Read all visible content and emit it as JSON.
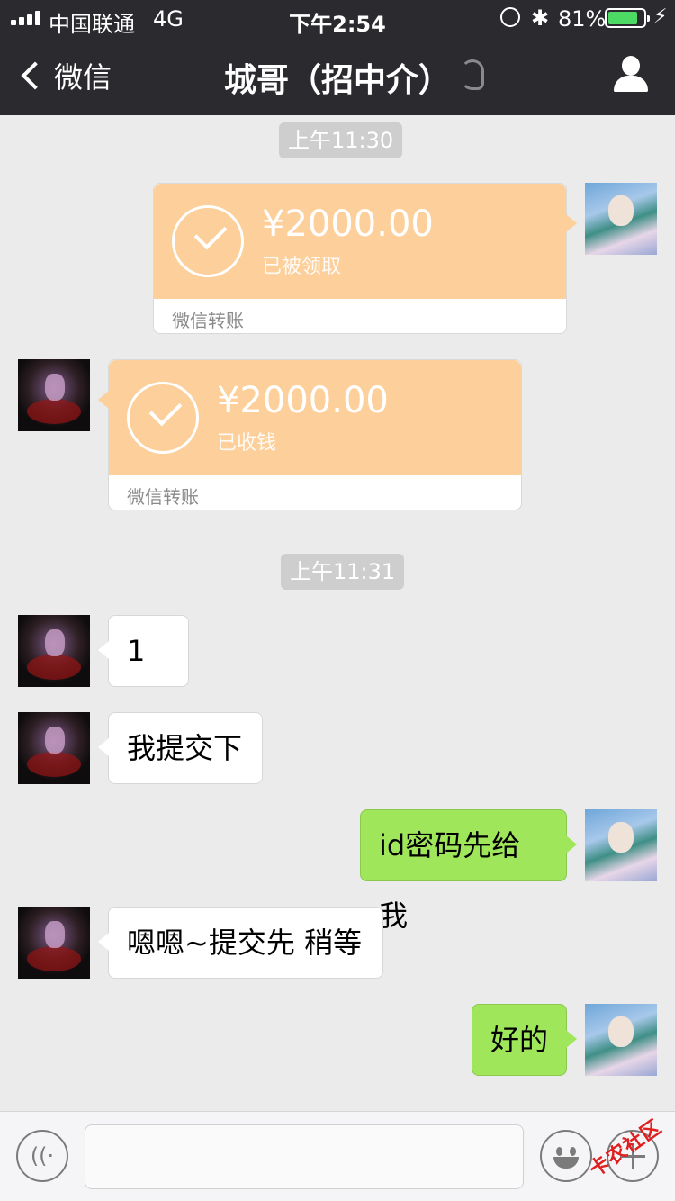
{
  "status_bar": {
    "carrier": "中国联通",
    "network": "4G",
    "time": "下午2:54",
    "battery_percent": "81%"
  },
  "nav": {
    "back_label": "微信",
    "title": "城哥（招中介）"
  },
  "messages": {
    "ts1": "上午11:30",
    "transfer_out": {
      "amount": "¥2000.00",
      "status": "已被领取",
      "footer": "微信转账"
    },
    "transfer_in": {
      "amount": "¥2000.00",
      "status": "已收钱",
      "footer": "微信转账"
    },
    "ts2": "上午11:31",
    "m1": "1",
    "m2": "我提交下",
    "m3": "id密码先给我",
    "m4": "嗯嗯~提交先  稍等",
    "m5": "好的"
  },
  "watermark": "卡农社区",
  "colors": {
    "nav_bg": "#2b2b2f",
    "transfer_bg": "#fdcf9a",
    "outgoing_bubble": "#9fe65b",
    "battery": "#4cd964"
  },
  "icons": [
    "chevron-left-icon",
    "ear-icon",
    "profile-icon",
    "voice-icon",
    "emoji-icon",
    "plus-icon"
  ]
}
